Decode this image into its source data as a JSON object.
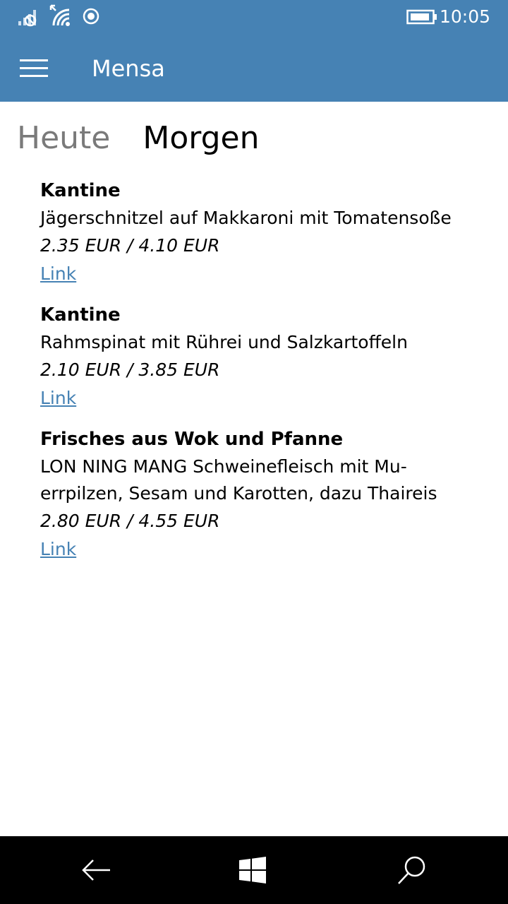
{
  "status_bar": {
    "icons": [
      "signal-off-icon",
      "wifi-icon",
      "location-icon",
      "battery-icon"
    ],
    "time": "10:05"
  },
  "app_bar": {
    "menu_icon": "hamburger-menu-icon",
    "title": "Mensa"
  },
  "pivot": {
    "tabs": [
      {
        "label": "Heute",
        "active": false
      },
      {
        "label": "Morgen",
        "active": true
      }
    ]
  },
  "menu": {
    "items": [
      {
        "location": "Kantine",
        "dish": "Jägerschnitzel auf Makkaroni mit Tomatensoße",
        "price": "2.35 EUR / 4.10 EUR",
        "link": "Link"
      },
      {
        "location": "Kantine",
        "dish": "Rahmspinat mit Rührei und Salzkartoffeln",
        "price": "2.10 EUR / 3.85 EUR",
        "link": "Link"
      },
      {
        "location": "Frisches aus Wok und Pfanne",
        "dish_line1": "LON NING MANG Schweinefleisch mit Mu-",
        "dish_line2": "errpilzen, Sesam und Karotten, dazu Thaireis",
        "price": "2.80 EUR / 4.55 EUR",
        "link": "Link"
      }
    ]
  },
  "nav_bar": {
    "buttons": [
      "back-arrow-icon",
      "windows-start-icon",
      "search-icon"
    ]
  },
  "colors": {
    "accent": "#4682b4",
    "nav_background": "#000000",
    "inactive_tab": "#7a7a7a"
  }
}
